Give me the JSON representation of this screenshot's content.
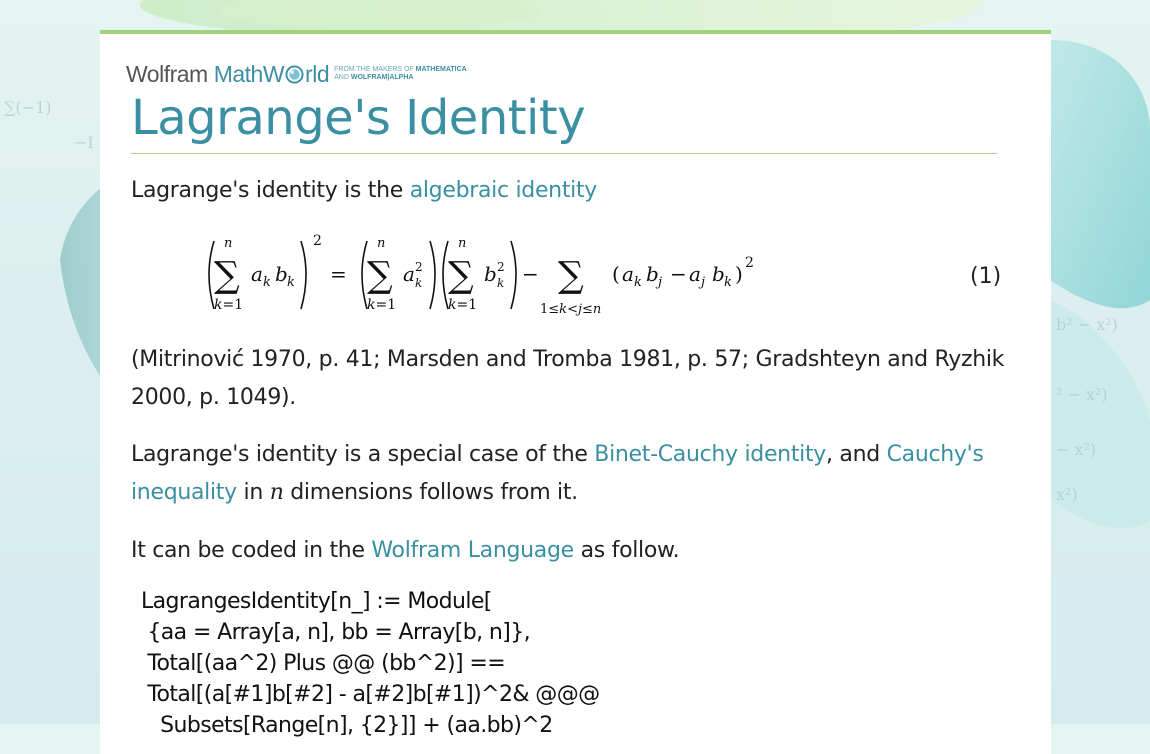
{
  "brand": {
    "wolfram": "Wolfram",
    "mathworld_a": "MathW",
    "mathworld_b": "rld",
    "tag_line1_a": "FROM THE MAKERS OF ",
    "tag_line1_b": "MATHEMATICA",
    "tag_line2_a": "AND ",
    "tag_line2_b": "WOLFRAM|ALPHA"
  },
  "page": {
    "title": "Lagrange's Identity"
  },
  "p1": {
    "text": "Lagrange's identity is the ",
    "link": "algebraic identity"
  },
  "equation": {
    "number": "(1)"
  },
  "p2": {
    "text": "(Mitrinović 1970, p. 41; Marsden and Tromba 1981, p. 57; Gradshteyn and Ryzhik 2000, p. 1049)."
  },
  "p3": {
    "text_a": "Lagrange's identity is a special case of the ",
    "link1": "Binet-Cauchy identity",
    "text_b": ", and ",
    "link2": "Cauchy's inequality",
    "text_c": " in ",
    "var": "n",
    "text_d": " dimensions follows from it."
  },
  "p4": {
    "text_a": "It can be coded in the ",
    "link": "Wolfram Language",
    "text_b": " as follow."
  },
  "code": {
    "lines": [
      "LagrangesIdentity[n_] := Module[",
      " {aa = Array[a, n], bb = Array[b, n]},",
      " Total[(aa^2) Plus @@ (bb^2)] ==",
      " Total[(a[#1]b[#2] - a[#2]b[#1])^2& @@@",
      "   Subsets[Range[n], {2}]] + (aa.bb)^2"
    ]
  },
  "colors": {
    "link": "#3a8fa3",
    "accent_green": "#9fd27a",
    "text": "#222222"
  }
}
